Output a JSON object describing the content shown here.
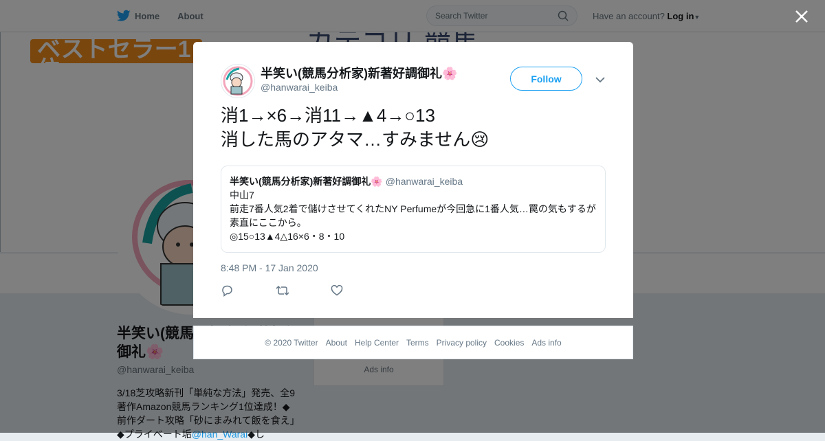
{
  "header": {
    "nav": [
      {
        "label": "Home",
        "icon": "twitter-bird-icon"
      },
      {
        "label": "About"
      }
    ],
    "search_placeholder": "Search Twitter",
    "account_prompt": "Have an account?",
    "login_label": "Log in"
  },
  "background": {
    "banner_left": "ベストセラー1位",
    "banner_right": "- カテゴリ 競馬",
    "profile_name": "半笑い(競馬分析家)新著好調御礼🌸",
    "profile_handle": "@hanwarai_keiba",
    "profile_bio": "3/18芝攻略新刊「単純な方法」発売、全9著作Amazon競馬ランキング1位達成！◆前作ダート攻略「砂にまみれて飯を食え」◆プライベート垢",
    "profile_bio_link": "@han_Warai",
    "profile_bio_tail": "◆し",
    "side_ads": "Ads info"
  },
  "tweet": {
    "name": "半笑い(競馬分析家)新著好調御礼🌸",
    "handle": "@hanwarai_keiba",
    "follow_label": "Follow",
    "text": "消1→×6→消11→▲4→○13\n消した馬のアタマ…すみません😢",
    "quote": {
      "name": "半笑い(競馬分析家)新著好調御礼🌸",
      "handle": "@hanwarai_keiba",
      "lines": [
        "中山7",
        "前走7番人気2着で儲けさせてくれたNY  Perfumeが今回急に1番人気…罠の気もするが素直にここから。",
        "◎15○13▲4△16×6・8・10"
      ]
    },
    "timestamp": "8:48 PM - 17 Jan 2020",
    "actions": [
      "reply-icon",
      "retweet-icon",
      "like-icon"
    ]
  },
  "footer": {
    "links": [
      "© 2020 Twitter",
      "About",
      "Help Center",
      "Terms",
      "Privacy policy",
      "Cookies",
      "Ads info"
    ]
  },
  "colors": {
    "accent": "#1da1f2",
    "overlay": "rgba(0,0,0,0.5)",
    "muted": "#657786"
  }
}
